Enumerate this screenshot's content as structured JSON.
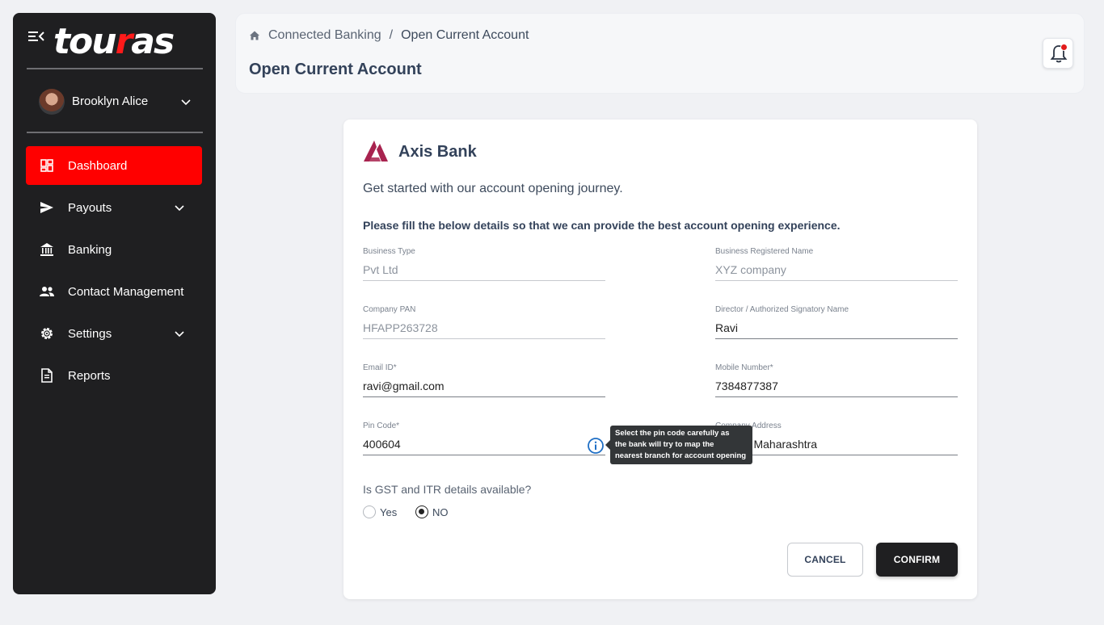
{
  "sidebar": {
    "logo": {
      "part1": "tou",
      "accent": "r",
      "part2": "as"
    },
    "user": {
      "name": "Brooklyn Alice"
    },
    "items": [
      {
        "label": "Dashboard",
        "icon": "dashboard-icon",
        "active": true
      },
      {
        "label": "Payouts",
        "icon": "send-icon",
        "has_children": true
      },
      {
        "label": "Banking",
        "icon": "bank-icon"
      },
      {
        "label": "Contact Management",
        "icon": "people-icon"
      },
      {
        "label": "Settings",
        "icon": "gear-icon",
        "has_children": true
      },
      {
        "label": "Reports",
        "icon": "document-icon"
      }
    ],
    "active_color": "#ff0000",
    "background": "#1f1f21"
  },
  "header": {
    "breadcrumb": {
      "parent": "Connected Banking",
      "separator": "/",
      "current": "Open Current Account"
    },
    "title": "Open Current Account"
  },
  "card": {
    "bank_name": "Axis Bank",
    "bank_color": "#a8234f",
    "intro": "Get started with our account opening journey.",
    "instructions": "Please fill the below details so that we can provide the best account opening experience.",
    "fields": {
      "business_type": {
        "label": "Business Type",
        "value": "Pvt Ltd"
      },
      "business_registered_name": {
        "label": "Business Registered Name",
        "value": "XYZ company"
      },
      "company_pan": {
        "label": "Company PAN",
        "value": "HFAPP263728"
      },
      "director_name": {
        "label": "Director / Authorized Signatory Name",
        "value": "Ravi"
      },
      "email": {
        "label": "Email ID*",
        "value": "ravi@gmail.com"
      },
      "mobile": {
        "label": "Mobile Number*",
        "value": "7384877387"
      },
      "pin_code": {
        "label": "Pin Code*",
        "value": "400604"
      },
      "company_address": {
        "label": "Company Address",
        "value": "Thane, Maharashtra"
      }
    },
    "tooltip": "Select the pin code carefully as\n the bank will try to map the\nnearest branch for account opening",
    "gst_question": "Is GST and ITR details available?",
    "radio_options": [
      {
        "label": "Yes",
        "checked": false
      },
      {
        "label": "NO",
        "checked": true
      }
    ],
    "cancel_label": "CANCEL",
    "confirm_label": "CONFIRM"
  }
}
